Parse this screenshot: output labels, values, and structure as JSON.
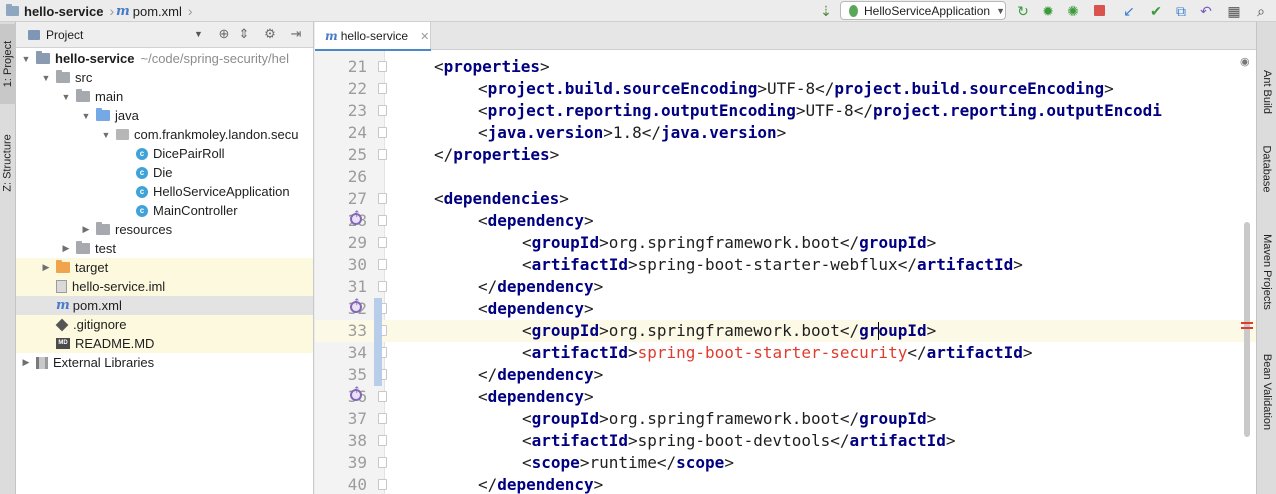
{
  "navbar": {
    "project": "hello-service",
    "file": "pom.xml",
    "run_config": "HelloServiceApplication"
  },
  "left_strip": {
    "project_tab": "1: Project",
    "structure_tab": "Z: Structure"
  },
  "project_panel": {
    "title": "Project",
    "tree": [
      {
        "label": "hello-service",
        "path": "~/code/spring-security/hel",
        "icon": "root-folder-icon",
        "caret": "open",
        "depth": 0,
        "bold": true
      },
      {
        "label": "src",
        "icon": "folder-icon",
        "caret": "open",
        "depth": 1
      },
      {
        "label": "main",
        "icon": "folder-icon",
        "caret": "open",
        "depth": 2
      },
      {
        "label": "java",
        "icon": "source-folder-icon",
        "caret": "open",
        "depth": 3
      },
      {
        "label": "com.frankmoley.landon.secu",
        "icon": "package-icon",
        "caret": "open",
        "depth": 4
      },
      {
        "label": "DicePairRoll",
        "icon": "class-icon",
        "caret": "none",
        "depth": 5
      },
      {
        "label": "Die",
        "icon": "class-icon",
        "caret": "none",
        "depth": 5
      },
      {
        "label": "HelloServiceApplication",
        "icon": "spring-class-icon",
        "caret": "none",
        "depth": 5
      },
      {
        "label": "MainController",
        "icon": "class-icon",
        "caret": "none",
        "depth": 5
      },
      {
        "label": "resources",
        "icon": "folder-icon",
        "caret": "closed",
        "depth": 3
      },
      {
        "label": "test",
        "icon": "folder-icon",
        "caret": "closed",
        "depth": 2
      },
      {
        "label": "target",
        "icon": "excluded-folder-icon",
        "caret": "closed",
        "depth": 1,
        "highlight": "yellow"
      },
      {
        "label": "hello-service.iml",
        "icon": "iml-file-icon",
        "caret": "none",
        "depth": 1,
        "highlight": "yellow"
      },
      {
        "label": "pom.xml",
        "icon": "maven-file-icon",
        "caret": "none",
        "depth": 1,
        "highlight": "selected"
      },
      {
        "label": ".gitignore",
        "icon": "gitignore-icon",
        "caret": "none",
        "depth": 1,
        "highlight": "yellow"
      },
      {
        "label": "README.MD",
        "icon": "markdown-icon",
        "caret": "none",
        "depth": 1,
        "highlight": "yellow"
      },
      {
        "label": "External Libraries",
        "icon": "libraries-icon",
        "caret": "closed",
        "depth": 0
      }
    ]
  },
  "editor": {
    "tab": {
      "label": "hello-service",
      "icon": "maven-file-icon"
    },
    "lines": [
      {
        "n": "21",
        "indent": 0,
        "parts": [
          [
            "t",
            "<"
          ],
          [
            "tag",
            "properties"
          ],
          [
            "t",
            ">"
          ]
        ]
      },
      {
        "n": "22",
        "indent": 1,
        "parts": [
          [
            "t",
            "<"
          ],
          [
            "tag",
            "project.build.sourceEncoding"
          ],
          [
            "t",
            ">UTF-8</"
          ],
          [
            "tag",
            "project.build.sourceEncoding"
          ],
          [
            "t",
            ">"
          ]
        ]
      },
      {
        "n": "23",
        "indent": 1,
        "parts": [
          [
            "t",
            "<"
          ],
          [
            "tag",
            "project.reporting.outputEncoding"
          ],
          [
            "t",
            ">UTF-8</"
          ],
          [
            "tag",
            "project.reporting.outputEncodi"
          ]
        ]
      },
      {
        "n": "24",
        "indent": 1,
        "parts": [
          [
            "t",
            "<"
          ],
          [
            "tag",
            "java.version"
          ],
          [
            "t",
            ">1.8</"
          ],
          [
            "tag",
            "java.version"
          ],
          [
            "t",
            ">"
          ]
        ]
      },
      {
        "n": "25",
        "indent": 0,
        "parts": [
          [
            "t",
            "</"
          ],
          [
            "tag",
            "properties"
          ],
          [
            "t",
            ">"
          ]
        ]
      },
      {
        "n": "26",
        "indent": 0,
        "parts": []
      },
      {
        "n": "27",
        "indent": 0,
        "parts": [
          [
            "t",
            "<"
          ],
          [
            "tag",
            "dependencies"
          ],
          [
            "t",
            ">"
          ]
        ]
      },
      {
        "n": "28",
        "indent": 1,
        "parts": [
          [
            "t",
            "<"
          ],
          [
            "tag",
            "dependency"
          ],
          [
            "t",
            ">"
          ]
        ]
      },
      {
        "n": "29",
        "indent": 2,
        "parts": [
          [
            "t",
            "<"
          ],
          [
            "tag",
            "groupId"
          ],
          [
            "t",
            ">org.springframework.boot</"
          ],
          [
            "tag",
            "groupId"
          ],
          [
            "t",
            ">"
          ]
        ]
      },
      {
        "n": "30",
        "indent": 2,
        "parts": [
          [
            "t",
            "<"
          ],
          [
            "tag",
            "artifactId"
          ],
          [
            "t",
            ">spring-boot-starter-webflux</"
          ],
          [
            "tag",
            "artifactId"
          ],
          [
            "t",
            ">"
          ]
        ]
      },
      {
        "n": "31",
        "indent": 1,
        "parts": [
          [
            "t",
            "</"
          ],
          [
            "tag",
            "dependency"
          ],
          [
            "t",
            ">"
          ]
        ]
      },
      {
        "n": "32",
        "indent": 1,
        "parts": [
          [
            "t",
            "<"
          ],
          [
            "tag",
            "dependency"
          ],
          [
            "t",
            ">"
          ]
        ]
      },
      {
        "n": "33",
        "indent": 2,
        "parts": [
          [
            "t",
            "<"
          ],
          [
            "tag",
            "groupId"
          ],
          [
            "t",
            ">org.springframework.boot</"
          ],
          [
            "tag",
            "groupId"
          ],
          [
            "t",
            ">"
          ]
        ]
      },
      {
        "n": "34",
        "indent": 2,
        "parts": [
          [
            "t",
            "<"
          ],
          [
            "tag",
            "artifactId"
          ],
          [
            "t",
            ">"
          ],
          [
            "err",
            "spring-boot-starter-security"
          ],
          [
            "t",
            "</"
          ],
          [
            "tag",
            "artifactId"
          ],
          [
            "t",
            ">"
          ]
        ]
      },
      {
        "n": "35",
        "indent": 1,
        "parts": [
          [
            "t",
            "</"
          ],
          [
            "tag",
            "dependency"
          ],
          [
            "t",
            ">"
          ]
        ]
      },
      {
        "n": "36",
        "indent": 1,
        "parts": [
          [
            "t",
            "<"
          ],
          [
            "tag",
            "dependency"
          ],
          [
            "t",
            ">"
          ]
        ]
      },
      {
        "n": "37",
        "indent": 2,
        "parts": [
          [
            "t",
            "<"
          ],
          [
            "tag",
            "groupId"
          ],
          [
            "t",
            ">org.springframework.boot</"
          ],
          [
            "tag",
            "groupId"
          ],
          [
            "t",
            ">"
          ]
        ]
      },
      {
        "n": "38",
        "indent": 2,
        "parts": [
          [
            "t",
            "<"
          ],
          [
            "tag",
            "artifactId"
          ],
          [
            "t",
            ">spring-boot-devtools</"
          ],
          [
            "tag",
            "artifactId"
          ],
          [
            "t",
            ">"
          ]
        ]
      },
      {
        "n": "39",
        "indent": 2,
        "parts": [
          [
            "t",
            "<"
          ],
          [
            "tag",
            "scope"
          ],
          [
            "t",
            ">runtime</"
          ],
          [
            "tag",
            "scope"
          ],
          [
            "t",
            ">"
          ]
        ]
      },
      {
        "n": "40",
        "indent": 1,
        "parts": [
          [
            "t",
            "</"
          ],
          [
            "tag",
            "dependency"
          ],
          [
            "t",
            ">"
          ]
        ]
      }
    ],
    "current_line": "33",
    "gutter_markers": [
      "28",
      "32",
      "36"
    ]
  },
  "right_strip": {
    "tabs": [
      "Ant Build",
      "Database",
      "Maven Projects",
      "Bean Validation"
    ]
  },
  "colors": {
    "tag": "#000080",
    "error": "#e03b2c",
    "selection_line": "#fcfae6",
    "tab_accent": "#4a88c7"
  }
}
